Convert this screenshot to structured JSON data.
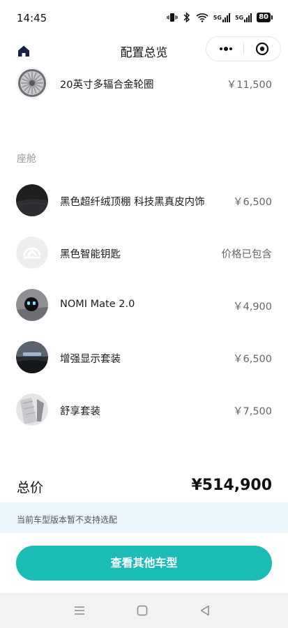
{
  "status_bar": {
    "time": "14:45",
    "signal1": "5G",
    "signal2": "5G",
    "battery": "80"
  },
  "nav": {
    "title": "配置总览"
  },
  "top_item": {
    "name": "20英寸多辐合金轮圈",
    "price": "￥11,500"
  },
  "cabin": {
    "title": "座舱",
    "items": [
      {
        "name": "黑色超纤绒顶棚 科技黑真皮内饰",
        "price": "￥6,500"
      },
      {
        "name": "黑色智能钥匙",
        "price": "价格已包含"
      },
      {
        "name": "NOMI Mate 2.0",
        "price": "￥4,900"
      },
      {
        "name": "增强显示套装",
        "price": "￥6,500"
      },
      {
        "name": "舒享套装",
        "price": "￥7,500"
      }
    ]
  },
  "total": {
    "label": "总价",
    "value": "¥514,900"
  },
  "notice": {
    "text": "当前车型版本暂不支持选配"
  },
  "cta": {
    "label": "查看其他车型"
  },
  "colors": {
    "accent": "#1abcb5",
    "notice_bg": "#eaf4fb"
  },
  "icons": [
    "vibrate-icon",
    "bluetooth-icon",
    "wifi-icon",
    "signal-icon",
    "battery-icon",
    "home-icon",
    "more-icon",
    "close-mini-program-icon",
    "wheel-icon",
    "ceiling-icon",
    "key-icon",
    "nomi-icon",
    "hud-icon",
    "seat-icon",
    "menu-icon",
    "square-icon",
    "back-icon"
  ]
}
